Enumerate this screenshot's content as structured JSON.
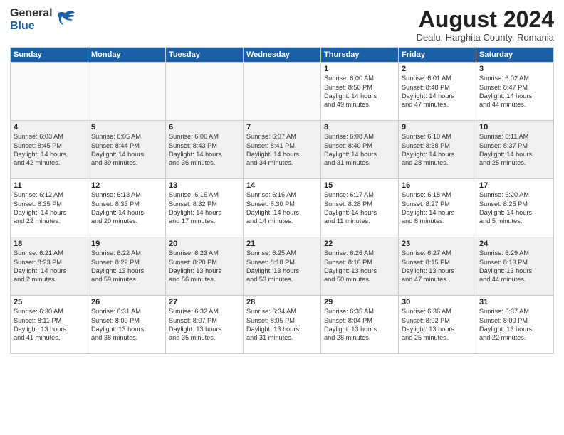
{
  "header": {
    "logo_line1": "General",
    "logo_line2": "Blue",
    "month_year": "August 2024",
    "location": "Dealu, Harghita County, Romania"
  },
  "weekdays": [
    "Sunday",
    "Monday",
    "Tuesday",
    "Wednesday",
    "Thursday",
    "Friday",
    "Saturday"
  ],
  "weeks": [
    [
      {
        "day": "",
        "info": ""
      },
      {
        "day": "",
        "info": ""
      },
      {
        "day": "",
        "info": ""
      },
      {
        "day": "",
        "info": ""
      },
      {
        "day": "1",
        "info": "Sunrise: 6:00 AM\nSunset: 8:50 PM\nDaylight: 14 hours\nand 49 minutes."
      },
      {
        "day": "2",
        "info": "Sunrise: 6:01 AM\nSunset: 8:48 PM\nDaylight: 14 hours\nand 47 minutes."
      },
      {
        "day": "3",
        "info": "Sunrise: 6:02 AM\nSunset: 8:47 PM\nDaylight: 14 hours\nand 44 minutes."
      }
    ],
    [
      {
        "day": "4",
        "info": "Sunrise: 6:03 AM\nSunset: 8:45 PM\nDaylight: 14 hours\nand 42 minutes."
      },
      {
        "day": "5",
        "info": "Sunrise: 6:05 AM\nSunset: 8:44 PM\nDaylight: 14 hours\nand 39 minutes."
      },
      {
        "day": "6",
        "info": "Sunrise: 6:06 AM\nSunset: 8:43 PM\nDaylight: 14 hours\nand 36 minutes."
      },
      {
        "day": "7",
        "info": "Sunrise: 6:07 AM\nSunset: 8:41 PM\nDaylight: 14 hours\nand 34 minutes."
      },
      {
        "day": "8",
        "info": "Sunrise: 6:08 AM\nSunset: 8:40 PM\nDaylight: 14 hours\nand 31 minutes."
      },
      {
        "day": "9",
        "info": "Sunrise: 6:10 AM\nSunset: 8:38 PM\nDaylight: 14 hours\nand 28 minutes."
      },
      {
        "day": "10",
        "info": "Sunrise: 6:11 AM\nSunset: 8:37 PM\nDaylight: 14 hours\nand 25 minutes."
      }
    ],
    [
      {
        "day": "11",
        "info": "Sunrise: 6:12 AM\nSunset: 8:35 PM\nDaylight: 14 hours\nand 22 minutes."
      },
      {
        "day": "12",
        "info": "Sunrise: 6:13 AM\nSunset: 8:33 PM\nDaylight: 14 hours\nand 20 minutes."
      },
      {
        "day": "13",
        "info": "Sunrise: 6:15 AM\nSunset: 8:32 PM\nDaylight: 14 hours\nand 17 minutes."
      },
      {
        "day": "14",
        "info": "Sunrise: 6:16 AM\nSunset: 8:30 PM\nDaylight: 14 hours\nand 14 minutes."
      },
      {
        "day": "15",
        "info": "Sunrise: 6:17 AM\nSunset: 8:28 PM\nDaylight: 14 hours\nand 11 minutes."
      },
      {
        "day": "16",
        "info": "Sunrise: 6:18 AM\nSunset: 8:27 PM\nDaylight: 14 hours\nand 8 minutes."
      },
      {
        "day": "17",
        "info": "Sunrise: 6:20 AM\nSunset: 8:25 PM\nDaylight: 14 hours\nand 5 minutes."
      }
    ],
    [
      {
        "day": "18",
        "info": "Sunrise: 6:21 AM\nSunset: 8:23 PM\nDaylight: 14 hours\nand 2 minutes."
      },
      {
        "day": "19",
        "info": "Sunrise: 6:22 AM\nSunset: 8:22 PM\nDaylight: 13 hours\nand 59 minutes."
      },
      {
        "day": "20",
        "info": "Sunrise: 6:23 AM\nSunset: 8:20 PM\nDaylight: 13 hours\nand 56 minutes."
      },
      {
        "day": "21",
        "info": "Sunrise: 6:25 AM\nSunset: 8:18 PM\nDaylight: 13 hours\nand 53 minutes."
      },
      {
        "day": "22",
        "info": "Sunrise: 6:26 AM\nSunset: 8:16 PM\nDaylight: 13 hours\nand 50 minutes."
      },
      {
        "day": "23",
        "info": "Sunrise: 6:27 AM\nSunset: 8:15 PM\nDaylight: 13 hours\nand 47 minutes."
      },
      {
        "day": "24",
        "info": "Sunrise: 6:29 AM\nSunset: 8:13 PM\nDaylight: 13 hours\nand 44 minutes."
      }
    ],
    [
      {
        "day": "25",
        "info": "Sunrise: 6:30 AM\nSunset: 8:11 PM\nDaylight: 13 hours\nand 41 minutes."
      },
      {
        "day": "26",
        "info": "Sunrise: 6:31 AM\nSunset: 8:09 PM\nDaylight: 13 hours\nand 38 minutes."
      },
      {
        "day": "27",
        "info": "Sunrise: 6:32 AM\nSunset: 8:07 PM\nDaylight: 13 hours\nand 35 minutes."
      },
      {
        "day": "28",
        "info": "Sunrise: 6:34 AM\nSunset: 8:05 PM\nDaylight: 13 hours\nand 31 minutes."
      },
      {
        "day": "29",
        "info": "Sunrise: 6:35 AM\nSunset: 8:04 PM\nDaylight: 13 hours\nand 28 minutes."
      },
      {
        "day": "30",
        "info": "Sunrise: 6:36 AM\nSunset: 8:02 PM\nDaylight: 13 hours\nand 25 minutes."
      },
      {
        "day": "31",
        "info": "Sunrise: 6:37 AM\nSunset: 8:00 PM\nDaylight: 13 hours\nand 22 minutes."
      }
    ]
  ]
}
